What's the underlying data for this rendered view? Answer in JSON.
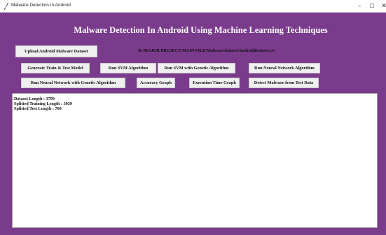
{
  "window": {
    "title": "Malware Detection In Android",
    "controls": {
      "minimize": "–",
      "maximize": "☐",
      "close": "✕"
    }
  },
  "colors": {
    "background": "#7a3b8c",
    "button": "#f0f0f0",
    "output_background": "#ffffff"
  },
  "heading": "Malware Detection In Android Using Machine Learning Techniques",
  "dataset_path": "D:/MAJOR PROJECT/MAIN FILE/Malware/dataset/AndroidDataset.csv",
  "buttons": {
    "upload": "Upload Android Malware Dataset",
    "generate": "Generate Train & Test Model",
    "run_svm": "Run SVM Algorithm",
    "run_svm_ga": "Run SVM with Genetic Algorithm",
    "run_nn": "Run Neural Network Algorithm",
    "run_nn_ga": "Run Neural Network with Genetic Algorithm",
    "accuracy_graph": "Accuracy Graph",
    "execution_time_graph": "Execution Time Graph",
    "detect_malware": "Detect Malware from Test Data"
  },
  "output": {
    "lines": [
      "Dataset Length : 3799",
      "Splitted Training Length : 3039",
      "Splitted Test Length : 760"
    ]
  }
}
